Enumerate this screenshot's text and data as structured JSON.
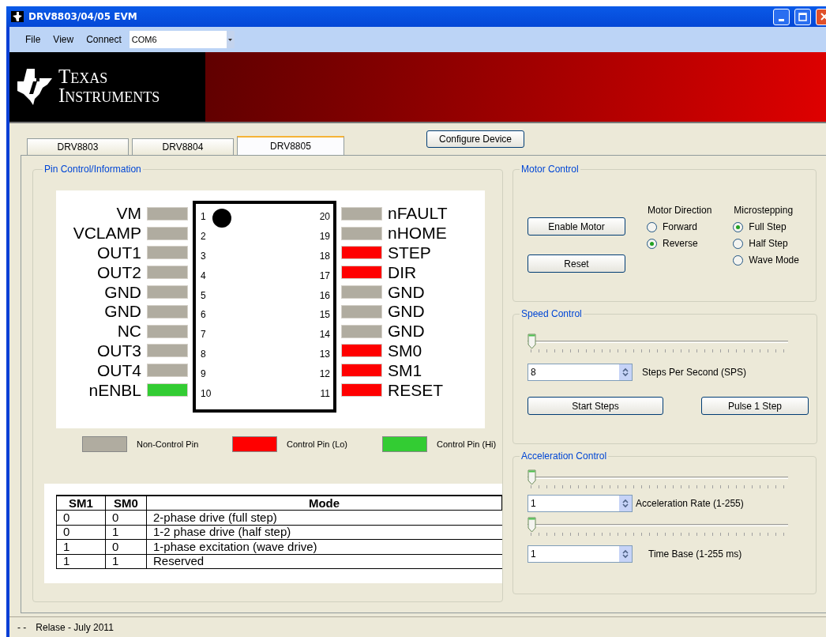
{
  "window": {
    "title": "DRV8803/04/05 EVM"
  },
  "menu": [
    "File",
    "View",
    "Connect"
  ],
  "port": {
    "value": "COM6"
  },
  "logo": {
    "line_1": "TEXAS",
    "line_2": "INSTRUMENTS"
  },
  "tabs": [
    {
      "label": "DRV8803",
      "selected": false
    },
    {
      "label": "DRV8804",
      "selected": false
    },
    {
      "label": "DRV8805",
      "selected": true
    }
  ],
  "configure_button": "Configure Device",
  "pin_panel": {
    "title": "Pin Control/Information",
    "left_pins": [
      {
        "name": "VM",
        "number": "1",
        "color": "#b0aca0"
      },
      {
        "name": "VCLAMP",
        "number": "2",
        "color": "#b0aca0"
      },
      {
        "name": "OUT1",
        "number": "3",
        "color": "#b0aca0"
      },
      {
        "name": "OUT2",
        "number": "4",
        "color": "#b0aca0"
      },
      {
        "name": "GND",
        "number": "5",
        "color": "#b0aca0"
      },
      {
        "name": "GND",
        "number": "6",
        "color": "#b0aca0"
      },
      {
        "name": "NC",
        "number": "7",
        "color": "#b0aca0"
      },
      {
        "name": "OUT3",
        "number": "8",
        "color": "#b0aca0"
      },
      {
        "name": "OUT4",
        "number": "9",
        "color": "#b0aca0"
      },
      {
        "name": "nENBL",
        "number": "10",
        "color": "#33cc33"
      }
    ],
    "right_pins": [
      {
        "name": "nFAULT",
        "number": "20",
        "color": "#b0aca0"
      },
      {
        "name": "nHOME",
        "number": "19",
        "color": "#b0aca0"
      },
      {
        "name": "STEP",
        "number": "18",
        "color": "#ff0000"
      },
      {
        "name": "DIR",
        "number": "17",
        "color": "#ff0000"
      },
      {
        "name": "GND",
        "number": "16",
        "color": "#b0aca0"
      },
      {
        "name": "GND",
        "number": "15",
        "color": "#b0aca0"
      },
      {
        "name": "GND",
        "number": "14",
        "color": "#b0aca0"
      },
      {
        "name": "SM0",
        "number": "13",
        "color": "#ff0000"
      },
      {
        "name": "SM1",
        "number": "12",
        "color": "#ff0000"
      },
      {
        "name": "RESET",
        "number": "11",
        "color": "#ff0000"
      }
    ],
    "legend": [
      {
        "label": "Non-Control Pin",
        "color": "#b0aca0"
      },
      {
        "label": "Control Pin (Lo)",
        "color": "#ff0000"
      },
      {
        "label": "Control Pin (Hi)",
        "color": "#33cc33"
      }
    ],
    "table": {
      "columns": [
        "SM1",
        "SM0",
        "Mode"
      ],
      "rows": [
        [
          "0",
          "0",
          "2-phase drive (full step)"
        ],
        [
          "0",
          "1",
          "1-2 phase drive (half step)"
        ],
        [
          "1",
          "0",
          "1-phase excitation (wave drive)"
        ],
        [
          "1",
          "1",
          "Reserved"
        ]
      ]
    }
  },
  "motor_control": {
    "title": "Motor Control",
    "buttons": [
      "Enable Motor",
      "Reset"
    ],
    "direction": {
      "label": "Motor Direction",
      "options": [
        {
          "label": "Forward",
          "selected": false
        },
        {
          "label": "Reverse",
          "selected": true
        }
      ]
    },
    "microstepping": {
      "label": "Microstepping",
      "options": [
        {
          "label": "Full Step",
          "selected": true
        },
        {
          "label": "Half Step",
          "selected": false
        },
        {
          "label": "Wave Mode",
          "selected": false
        }
      ]
    }
  },
  "speed_control": {
    "title": "Speed Control",
    "slider": {
      "level": 0
    },
    "value": "8",
    "label": "Steps Per Second (SPS)",
    "buttons": [
      "Start Steps",
      "Pulse 1 Step"
    ]
  },
  "acceleration_control": {
    "title": "Acceleration Control",
    "rate_slider": {
      "level": 0
    },
    "rate_value": "1",
    "rate_label": "Acceleration Rate (1-255)",
    "time_slider": {
      "level": 0
    },
    "time_value": "1",
    "time_label": "Time Base (1-255 ms)"
  },
  "status_bar": {
    "dashes": "- -",
    "text": "Relase - July 2011"
  }
}
